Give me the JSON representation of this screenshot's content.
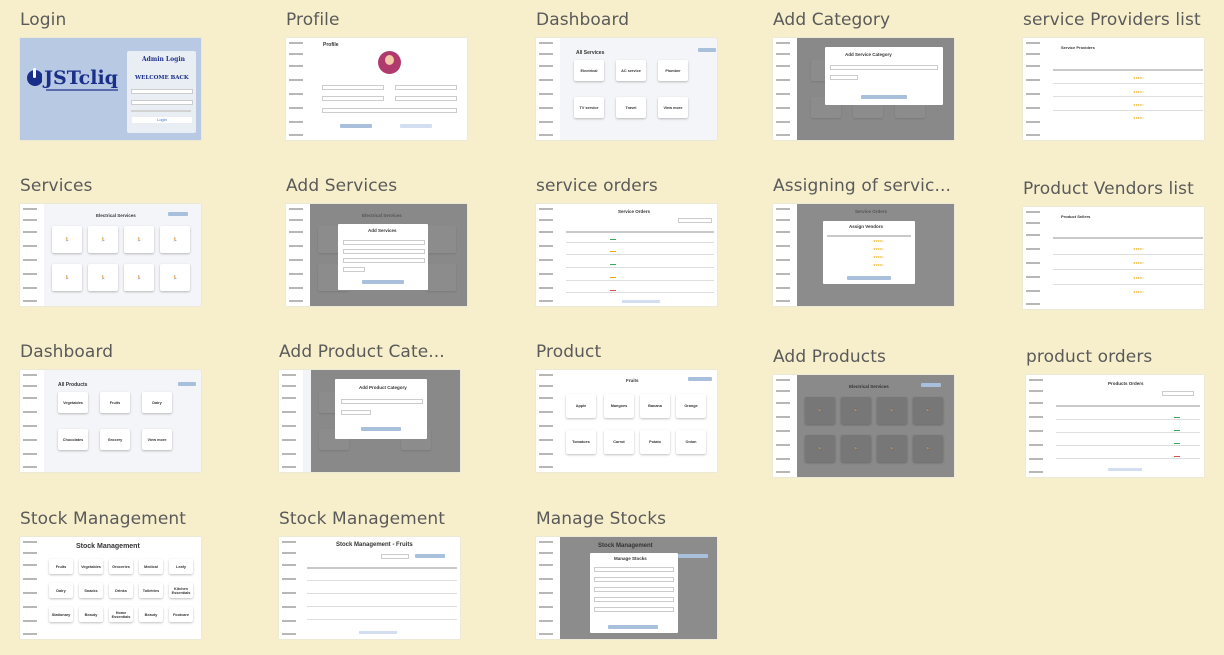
{
  "cards": {
    "login": {
      "title": "Login",
      "logo_text": "JSTcliq",
      "panel_title": "Admin Login",
      "welcome": "WELCOME BACK",
      "button": "Login"
    },
    "profile": {
      "title": "Profile",
      "heading": "Profile"
    },
    "dashboard1": {
      "title": "Dashboard",
      "heading": "All Services",
      "tiles": [
        "Electrical",
        "AC service",
        "Plumber",
        "TV service",
        "Travel",
        "View more"
      ]
    },
    "add_category": {
      "title": "Add Category",
      "modal_title": "Add Service Category"
    },
    "service_providers": {
      "title": "service Providers list",
      "heading": "Service Providers"
    },
    "services": {
      "title": "Services",
      "heading": "Electrical Services"
    },
    "add_services": {
      "title": "Add Services",
      "heading": "Electrical Services",
      "modal_title": "Add Services"
    },
    "service_orders": {
      "title": "service orders",
      "heading": "Service Orders"
    },
    "assigning": {
      "title": "Assigning of servic...",
      "heading": "Service Orders",
      "modal_title": "Assign Vendors"
    },
    "product_vendors": {
      "title": "Product Vendors list",
      "heading": "Product Sellers"
    },
    "dashboard2": {
      "title": "Dashboard",
      "heading": "All Products",
      "tiles": [
        "Vegetables",
        "Fruits",
        "Dairy",
        "Chocolates",
        "Grocery",
        "View more"
      ]
    },
    "add_product_category": {
      "title": "Add Product Cate...",
      "modal_title": "Add Product Category"
    },
    "product": {
      "title": "Product",
      "heading": "Fruits",
      "tiles": [
        "Apple",
        "Mangoes",
        "Banana",
        "Orange",
        "Tomatoes",
        "Carrot",
        "Potato",
        "Onion"
      ]
    },
    "add_products": {
      "title": "Add Products",
      "heading": "Electrical Services"
    },
    "product_orders": {
      "title": "product orders",
      "heading": "Products Orders"
    },
    "stock1": {
      "title": "Stock Management",
      "heading": "Stock Management",
      "tiles": [
        "Fruits",
        "Vegetables",
        "Groceries",
        "Medical",
        "Leafy",
        "Dairy",
        "Snacks",
        "Drinks",
        "Toiletries",
        "Kitchen Essentials",
        "Stationary",
        "Beauty",
        "Home Essentials",
        "Beauty",
        "Footcare"
      ]
    },
    "stock2": {
      "title": "Stock Management",
      "heading": "Stock Management - Fruits"
    },
    "manage_stocks": {
      "title": "Manage Stocks",
      "heading": "Stock Management",
      "modal_title": "Manage Stocks"
    }
  },
  "colors": {
    "background": "#f7efcb",
    "accent": "#a9c0dc",
    "logo_blue": "#1a2f8a"
  }
}
